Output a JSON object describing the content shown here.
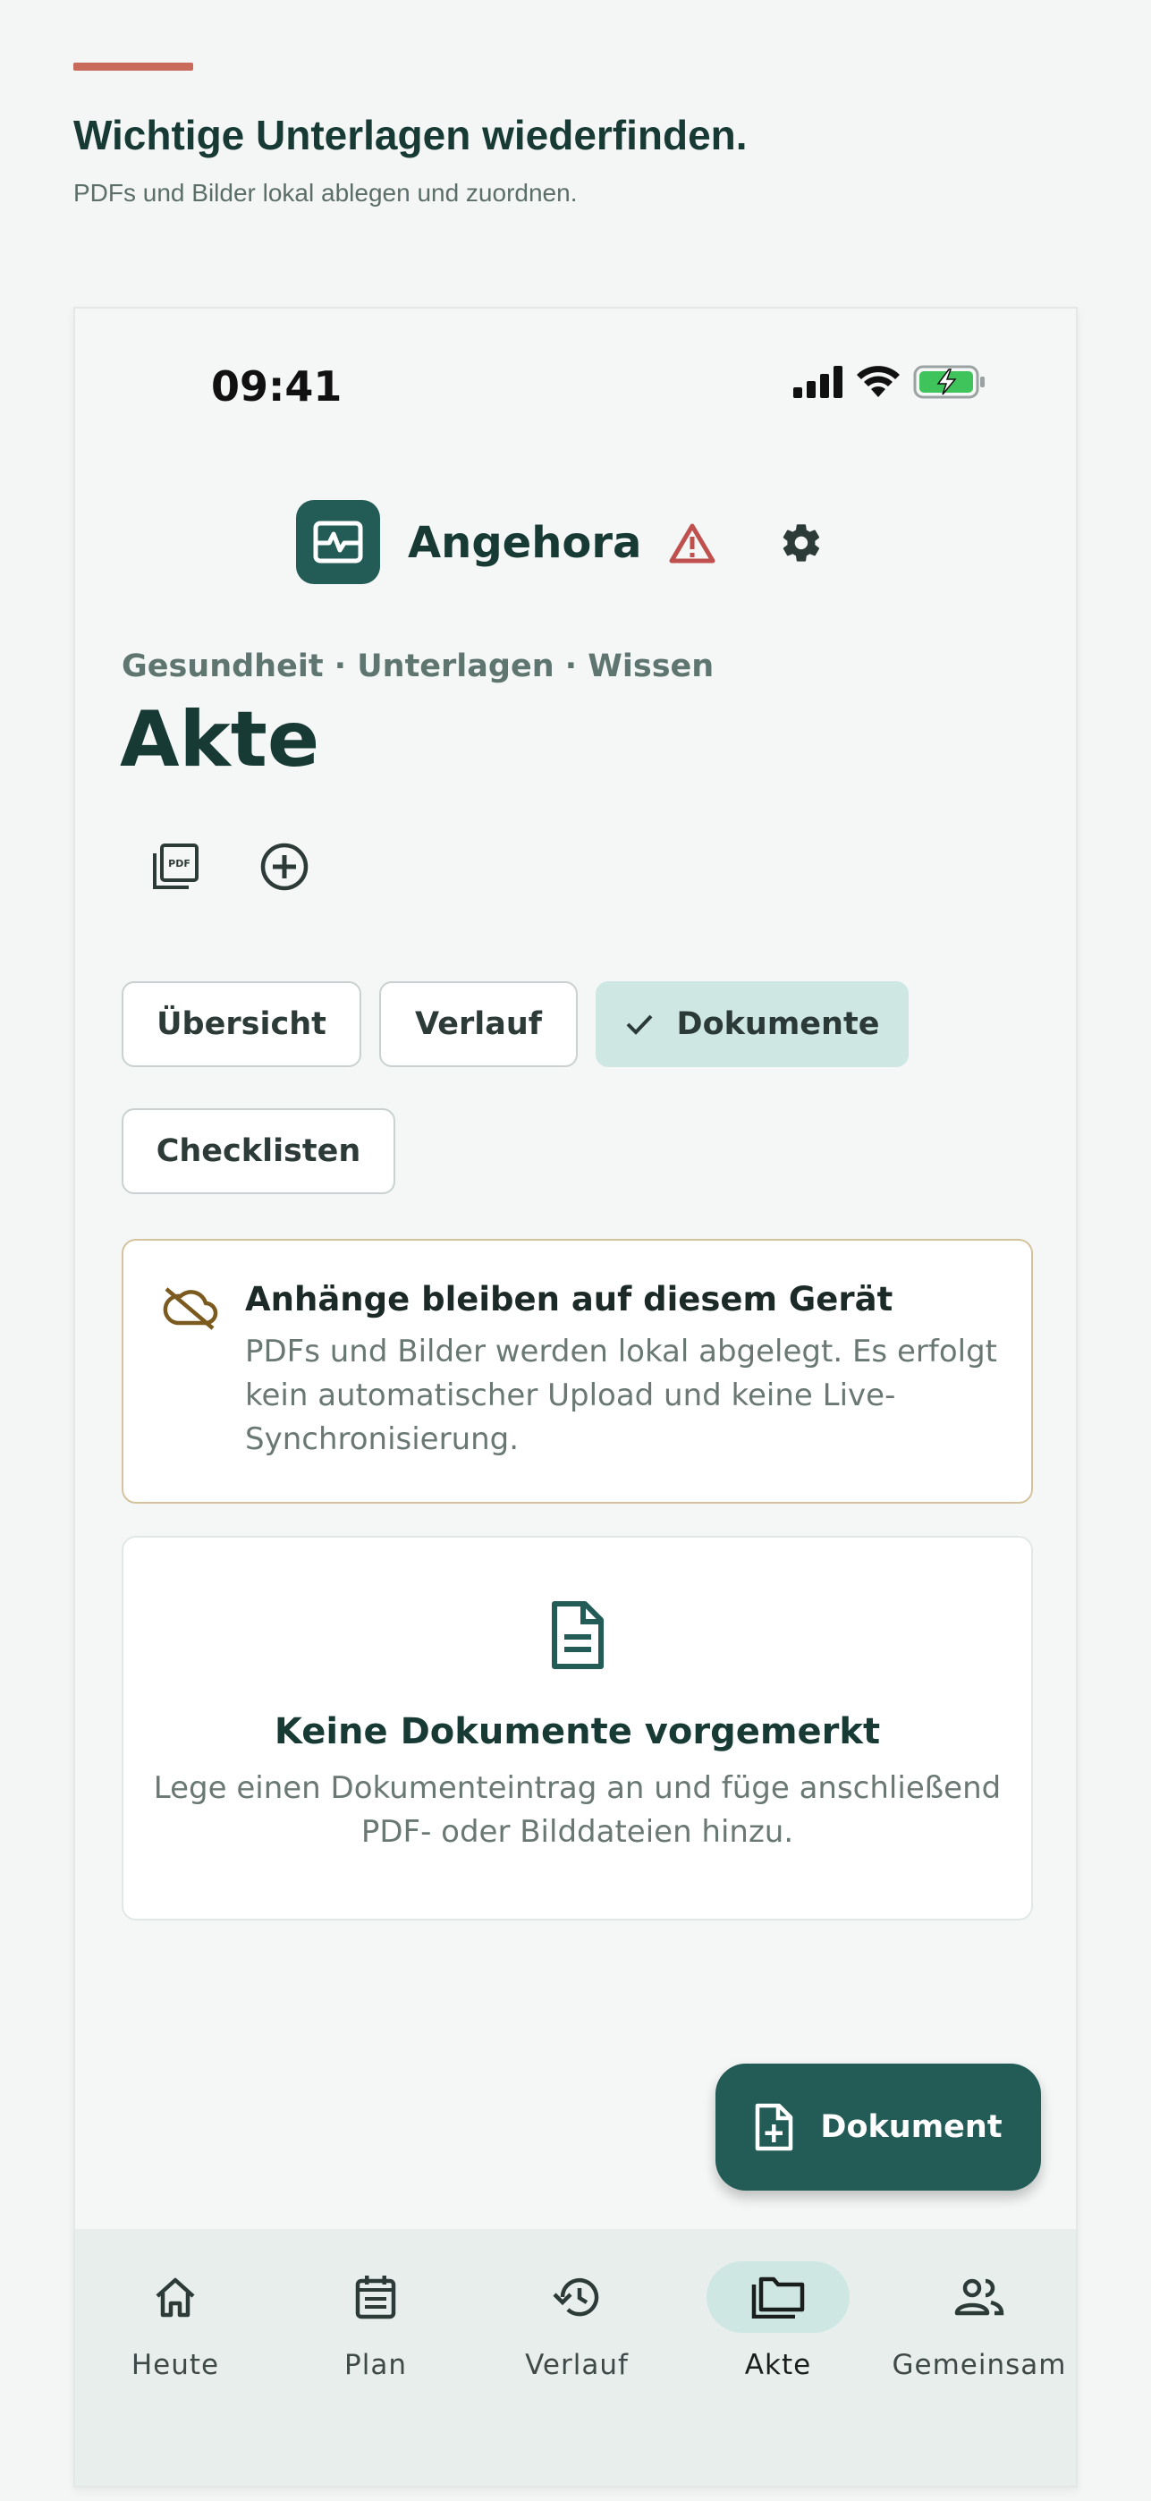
{
  "header": {
    "headline": "Wichtige Unterlagen wiederfinden.",
    "subline": "PDFs und Bilder lokal ablegen und zuordnen."
  },
  "status_bar": {
    "time": "09:41"
  },
  "app": {
    "name": "Angehora"
  },
  "page": {
    "breadcrumb": "Gesundheit · Unterlagen · Wissen",
    "title": "Akte"
  },
  "tabs": [
    {
      "label": "Übersicht",
      "selected": false
    },
    {
      "label": "Verlauf",
      "selected": false
    },
    {
      "label": "Dokumente",
      "selected": true
    },
    {
      "label": "Checklisten",
      "selected": false
    }
  ],
  "info_card": {
    "icon": "cloud-off-icon",
    "title": "Anhänge bleiben auf diesem Gerät",
    "body": "PDFs und Bilder werden lokal abgelegt. Es erfolgt kein automatischer Upload und keine Live-Synchronisierung."
  },
  "empty_state": {
    "icon": "document-icon",
    "title": "Keine Dokumente vorgemerkt",
    "body": "Lege einen Dokumenteintrag an und füge anschließend PDF- oder Bilddateien hinzu."
  },
  "fab": {
    "label": "Dokument",
    "icon": "note-add-icon"
  },
  "bottom_nav": [
    {
      "label": "Heute",
      "icon": "home-icon",
      "active": false
    },
    {
      "label": "Plan",
      "icon": "calendar-icon",
      "active": false
    },
    {
      "label": "Verlauf",
      "icon": "history-icon",
      "active": false
    },
    {
      "label": "Akte",
      "icon": "folder-icon",
      "active": true
    },
    {
      "label": "Gemeinsam",
      "icon": "people-icon",
      "active": false
    }
  ],
  "colors": {
    "brand": "#235c56",
    "accent": "#c86b5a",
    "chip_selected": "#cfe7e3",
    "warning": "#c0504d",
    "info_border": "#d5c39d"
  }
}
